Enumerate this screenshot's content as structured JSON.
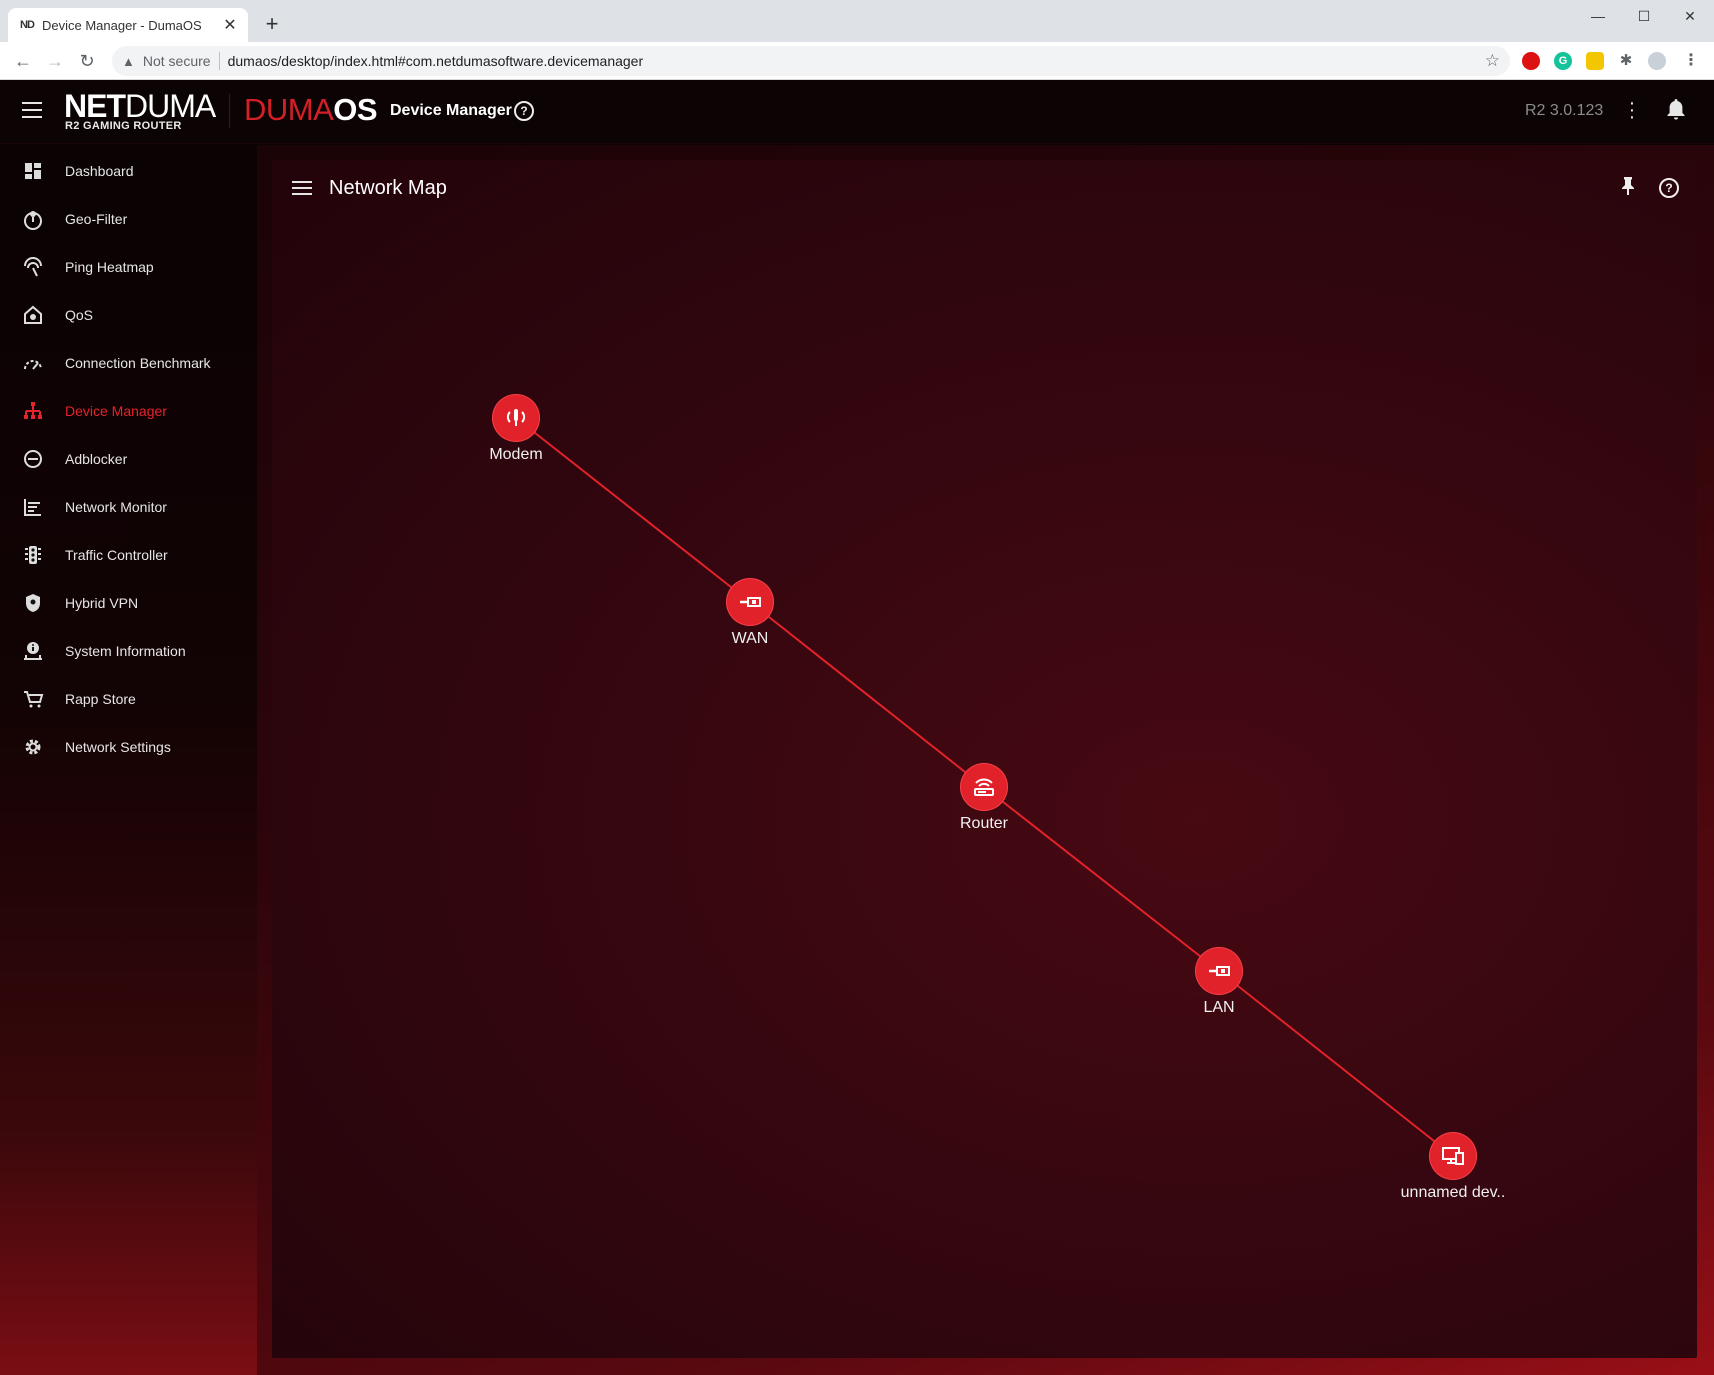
{
  "browser": {
    "tab_title": "Device Manager - DumaOS",
    "favicon_text": "ND",
    "not_secure": "Not secure",
    "url": "dumaos/desktop/index.html#com.netdumasoftware.devicemanager"
  },
  "header": {
    "logo_net": "NET",
    "logo_duma": "DUMA",
    "logo_subtitle": "R2 GAMING ROUTER",
    "os_duma": "DUMA",
    "os_os": "OS",
    "page_name": "Device Manager",
    "version": "R2 3.0.123"
  },
  "sidebar": {
    "items": [
      {
        "label": "Dashboard",
        "icon": "dashboard-icon"
      },
      {
        "label": "Geo-Filter",
        "icon": "geo-filter-icon"
      },
      {
        "label": "Ping Heatmap",
        "icon": "ping-heatmap-icon"
      },
      {
        "label": "QoS",
        "icon": "qos-icon"
      },
      {
        "label": "Connection Benchmark",
        "icon": "speedometer-icon"
      },
      {
        "label": "Device Manager",
        "icon": "network-tree-icon"
      },
      {
        "label": "Adblocker",
        "icon": "block-icon"
      },
      {
        "label": "Network Monitor",
        "icon": "bars-icon"
      },
      {
        "label": "Traffic Controller",
        "icon": "traffic-light-icon"
      },
      {
        "label": "Hybrid VPN",
        "icon": "shield-icon"
      },
      {
        "label": "System Information",
        "icon": "info-icon"
      },
      {
        "label": "Rapp Store",
        "icon": "cart-icon"
      },
      {
        "label": "Network Settings",
        "icon": "gear-icon"
      }
    ],
    "active": "Device Manager"
  },
  "card": {
    "title": "Network Map"
  },
  "network_map": {
    "nodes": [
      {
        "label": "Modem",
        "icon": "modem-icon"
      },
      {
        "label": "WAN",
        "icon": "ethernet-port-icon"
      },
      {
        "label": "Router",
        "icon": "router-icon"
      },
      {
        "label": "LAN",
        "icon": "ethernet-port-icon"
      },
      {
        "label": "unnamed dev..",
        "icon": "devices-icon"
      }
    ],
    "link_color": "#e2222a"
  },
  "colors": {
    "accent": "#e2222a",
    "active_nav": "#e5242c"
  }
}
